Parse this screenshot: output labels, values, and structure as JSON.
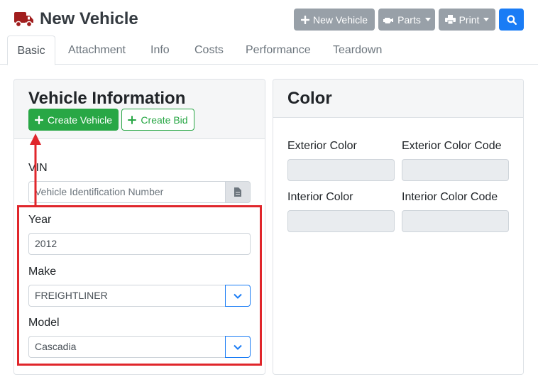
{
  "header": {
    "title": "New Vehicle",
    "buttons": {
      "new_vehicle": "New Vehicle",
      "parts": "Parts",
      "print": "Print"
    }
  },
  "tabs": [
    {
      "label": "Basic",
      "active": true
    },
    {
      "label": "Attachment"
    },
    {
      "label": "Info"
    },
    {
      "label": "Costs"
    },
    {
      "label": "Performance"
    },
    {
      "label": "Teardown"
    }
  ],
  "vehicle_info": {
    "title": "Vehicle Information",
    "create_vehicle": "Create Vehicle",
    "create_bid": "Create Bid",
    "vin": {
      "label": "VIN",
      "placeholder": "Vehicle Identification Number"
    },
    "year": {
      "label": "Year",
      "value": "2012"
    },
    "make": {
      "label": "Make",
      "value": "FREIGHTLINER"
    },
    "model": {
      "label": "Model",
      "value": "Cascadia"
    }
  },
  "color": {
    "title": "Color",
    "exterior_color": {
      "label": "Exterior Color",
      "value": ""
    },
    "exterior_color_code": {
      "label": "Exterior Color Code",
      "value": ""
    },
    "interior_color": {
      "label": "Interior Color",
      "value": ""
    },
    "interior_color_code": {
      "label": "Interior Color Code",
      "value": ""
    }
  },
  "colors": {
    "brand_icon": "#a11e1e",
    "primary": "#1a7cf5",
    "success": "#28a745",
    "secondary": "#98a0a8",
    "annotation": "#e0262b"
  },
  "icons": [
    "truck-icon",
    "plus-icon",
    "engine-icon",
    "printer-icon",
    "search-icon",
    "document-icon",
    "chevron-down-icon"
  ]
}
